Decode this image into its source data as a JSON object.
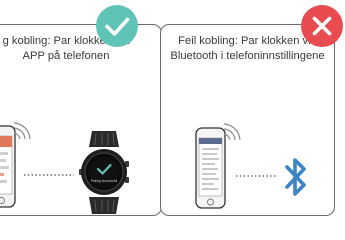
{
  "left_panel": {
    "caption_line1": "g kobling: Par klokken via",
    "caption_line2": "APP på telefonen",
    "badge": {
      "icon": "check-icon",
      "color": "#5fc4b6"
    },
    "watch_screen_text": "Pairing successful"
  },
  "right_panel": {
    "caption_line1": "Feil kobling: Par klokken via",
    "caption_line2": "Bluetooth i telefoninnstillingene",
    "badge": {
      "icon": "close-icon",
      "color": "#e84b50"
    },
    "bluetooth_color": "#3b85c4"
  }
}
